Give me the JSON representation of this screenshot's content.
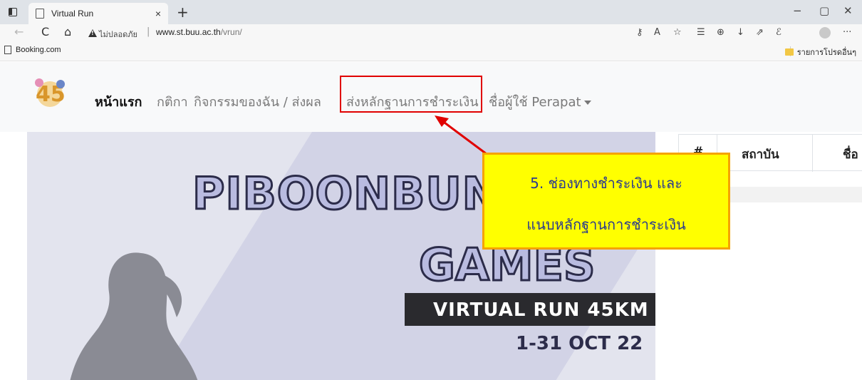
{
  "browser": {
    "tab_title": "Virtual Run",
    "tab_close": "×",
    "new_tab": "+",
    "window_controls": [
      "−",
      "▢",
      "✕"
    ],
    "nav": {
      "back": "←",
      "reload": "C",
      "home": "⌂"
    },
    "not_secure_label": "ไม่ปลอดภัย",
    "separator": "|",
    "url_host": "www.st.buu.ac.th",
    "url_path": "/vrun/",
    "toolbar_icons": [
      "key-icon",
      "read-aloud-icon",
      "favorite-add-icon",
      "favorites-icon",
      "collections-icon",
      "downloads-icon",
      "share-icon",
      "extensions-icon",
      "profile-icon",
      "more-icon"
    ],
    "more": "···",
    "favorites": {
      "item": "Booking.com",
      "other": "รายการโปรดอื่นๆ"
    }
  },
  "navbar": {
    "home": "หน้าแรก",
    "rules": "กติกา",
    "my_activity": "กิจกรรมของฉัน / ส่งผล",
    "send_payment": "ส่งหลักฐานการชำระเงิน",
    "user": "ชื่อผู้ใช้ Perapat"
  },
  "banner": {
    "title": "PIBOONBUN",
    "title2": "GAMES",
    "subtitle": "VIRTUAL RUN 45KM",
    "date": "1-31 OCT 22",
    "logo_text": "45"
  },
  "table": {
    "headers": [
      "#",
      "สถาบัน",
      "ชื่อ"
    ]
  },
  "callout": {
    "line1": "5. ช่องทางชำระเงิน และ",
    "line2": "แนบหลักฐานการชำระเงิน"
  },
  "colors": {
    "highlight": "#e00000",
    "callout_bg": "#ffff00",
    "callout_border": "#f5a300",
    "callout_text": "#2b3a8f"
  }
}
